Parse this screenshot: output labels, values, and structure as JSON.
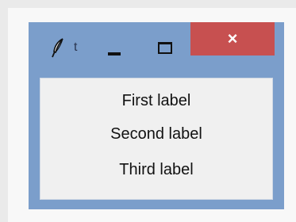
{
  "window": {
    "title": "t",
    "icon": "feather-icon",
    "controls": {
      "minimize_icon": "minimize-icon",
      "maximize_icon": "maximize-icon",
      "close_label": "×"
    },
    "colors": {
      "frame": "#7b9ecb",
      "close_button": "#c75050",
      "client_background": "#f0f0f0"
    }
  },
  "labels": [
    "First label",
    "Second label",
    "Third label"
  ]
}
